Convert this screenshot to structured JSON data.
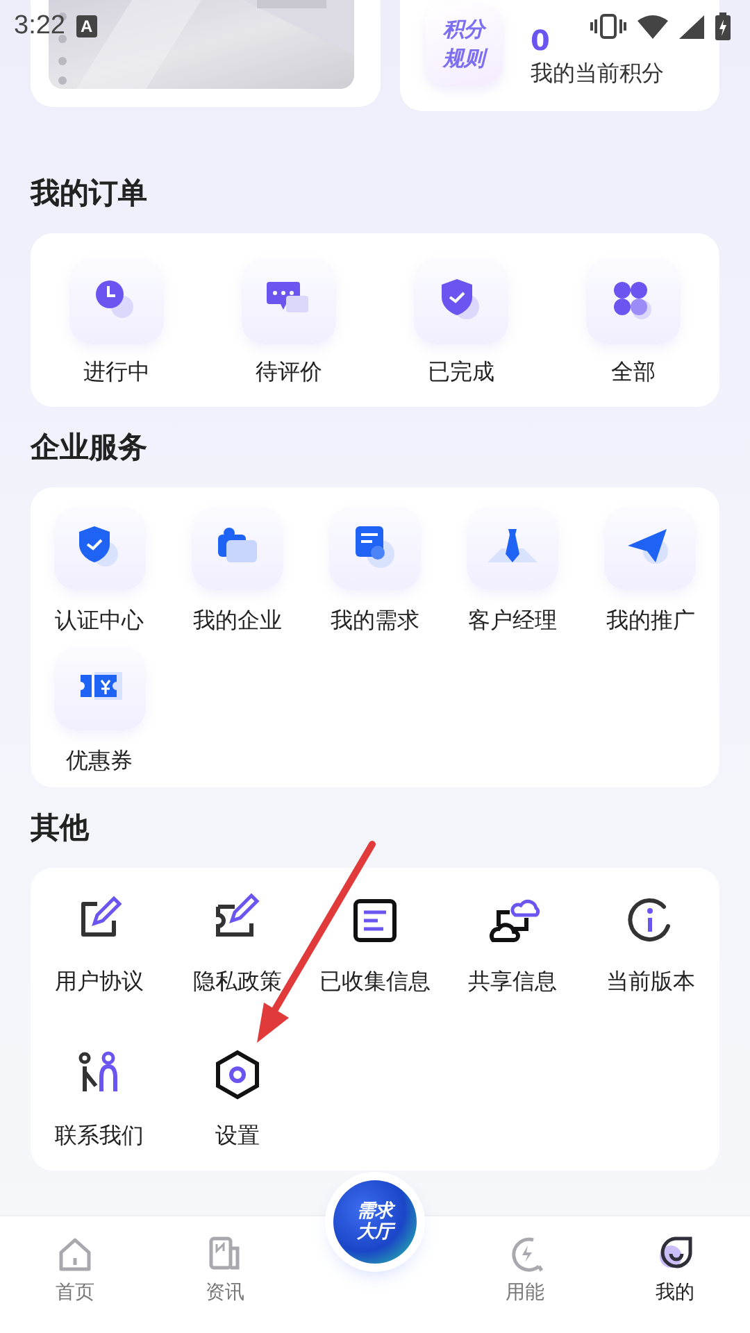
{
  "status_bar": {
    "time": "3:22",
    "notification": "A"
  },
  "points_card": {
    "rules_badge": "积分规则",
    "points": "0",
    "label": "我的当前积分"
  },
  "orders": {
    "title": "我的订单",
    "items": [
      {
        "label": "进行中"
      },
      {
        "label": "待评价"
      },
      {
        "label": "已完成"
      },
      {
        "label": "全部"
      }
    ]
  },
  "enterprise": {
    "title": "企业服务",
    "items": [
      {
        "label": "认证中心"
      },
      {
        "label": "我的企业"
      },
      {
        "label": "我的需求"
      },
      {
        "label": "客户经理"
      },
      {
        "label": "我的推广"
      },
      {
        "label": "优惠券"
      }
    ]
  },
  "other": {
    "title": "其他",
    "items": [
      {
        "label": "用户协议"
      },
      {
        "label": "隐私政策"
      },
      {
        "label": "已收集信息"
      },
      {
        "label": "共享信息"
      },
      {
        "label": "当前版本"
      },
      {
        "label": "联系我们"
      },
      {
        "label": "设置"
      }
    ]
  },
  "bottom_nav": {
    "center_button": "需求大厅",
    "tabs": [
      {
        "label": "首页",
        "selected": false
      },
      {
        "label": "资讯",
        "selected": false
      },
      {
        "label": "用能",
        "selected": false
      },
      {
        "label": "我的",
        "selected": true
      }
    ]
  }
}
